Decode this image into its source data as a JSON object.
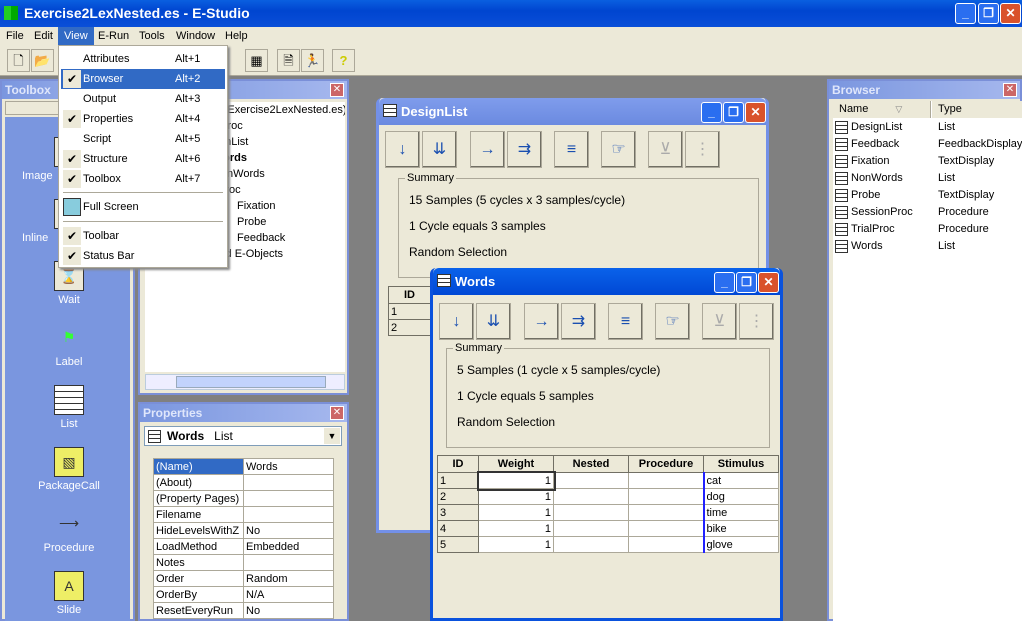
{
  "window": {
    "title": "Exercise2LexNested.es - E-Studio",
    "controls": [
      "_",
      "❐",
      "✕"
    ]
  },
  "menubar": [
    "File",
    "Edit",
    "View",
    "E-Run",
    "Tools",
    "Window",
    "Help"
  ],
  "toolbar": {
    "icons": [
      "new-icon",
      "open-icon",
      "properties-icon",
      "document-icon",
      "run-icon",
      "help-icon"
    ],
    "glyphs": [
      "🗋",
      "📂",
      "▦",
      "🗎",
      "🏃",
      "?"
    ]
  },
  "view_menu": {
    "items": [
      {
        "label": "Attributes",
        "shortcut": "Alt+1",
        "checked": false
      },
      {
        "label": "Browser",
        "shortcut": "Alt+2",
        "checked": true,
        "highlighted": true
      },
      {
        "label": "Output",
        "shortcut": "Alt+3",
        "checked": false
      },
      {
        "label": "Properties",
        "shortcut": "Alt+4",
        "checked": true
      },
      {
        "label": "Script",
        "shortcut": "Alt+5",
        "checked": false
      },
      {
        "label": "Structure",
        "shortcut": "Alt+6",
        "checked": true
      },
      {
        "label": "Toolbox",
        "shortcut": "Alt+7",
        "checked": true
      }
    ],
    "full_screen": "Full Screen",
    "bottom": [
      {
        "label": "Toolbar",
        "checked": true
      },
      {
        "label": "Status Bar",
        "checked": true
      }
    ],
    "check": "✔"
  },
  "toolbox": {
    "title": "Toolbox",
    "items": [
      "Image",
      "Inline",
      "Wait",
      "Label",
      "List",
      "PackageCall",
      "Procedure",
      "Slide"
    ]
  },
  "structure": {
    "items": [
      "Experiment (Exercise2LexNested.es)",
      "SessionProc",
      "DesignList",
      "Words",
      "NonWords",
      "TrialProc",
      "Fixation",
      "Probe",
      "Feedback",
      "Unreferenced E-Objects"
    ]
  },
  "properties": {
    "title": "Properties",
    "object_name": "Words",
    "object_type": "List",
    "rows": [
      [
        "(Name)",
        "Words"
      ],
      [
        "(About)",
        ""
      ],
      [
        "(Property Pages)",
        ""
      ],
      [
        "Filename",
        ""
      ],
      [
        "HideLevelsWithZ",
        "No"
      ],
      [
        "LoadMethod",
        "Embedded"
      ],
      [
        "Notes",
        ""
      ],
      [
        "Order",
        "Random"
      ],
      [
        "OrderBy",
        "N/A"
      ],
      [
        "ResetEveryRun",
        "No"
      ]
    ]
  },
  "designlist": {
    "title": "DesignList",
    "summary_label": "Summary",
    "summary": [
      "15 Samples (5 cycles x 3 samples/cycle)",
      "1 Cycle equals 3 samples",
      "Random Selection"
    ],
    "id_header": "ID",
    "ids": [
      "1",
      "2"
    ]
  },
  "words": {
    "title": "Words",
    "summary_label": "Summary",
    "summary": [
      "5 Samples (1 cycle x 5 samples/cycle)",
      "1 Cycle equals 5 samples",
      "Random Selection"
    ],
    "headers": [
      "ID",
      "Weight",
      "Nested",
      "Procedure",
      "Stimulus"
    ],
    "rows": [
      [
        "1",
        "1",
        "",
        "",
        "cat"
      ],
      [
        "2",
        "1",
        "",
        "",
        "dog"
      ],
      [
        "3",
        "1",
        "",
        "",
        "time"
      ],
      [
        "4",
        "1",
        "",
        "",
        "bike"
      ],
      [
        "5",
        "1",
        "",
        "",
        "glove"
      ]
    ]
  },
  "list_toolbar_glyphs": [
    "↓",
    "⇊",
    "→",
    "⇉",
    "≡",
    "☞",
    "⊻",
    "⋮"
  ],
  "browser": {
    "title": "Browser",
    "headers": [
      "Name",
      "Type"
    ],
    "rows": [
      [
        "DesignList",
        "List"
      ],
      [
        "Feedback",
        "FeedbackDisplay"
      ],
      [
        "Fixation",
        "TextDisplay"
      ],
      [
        "NonWords",
        "List"
      ],
      [
        "Probe",
        "TextDisplay"
      ],
      [
        "SessionProc",
        "Procedure"
      ],
      [
        "TrialProc",
        "Procedure"
      ],
      [
        "Words",
        "List"
      ]
    ]
  },
  "close_glyph": "✕",
  "colors": {
    "title_active": "#0a52dd",
    "menu_highlight": "#316ac5",
    "toolbox_bg": "#7a96df"
  }
}
